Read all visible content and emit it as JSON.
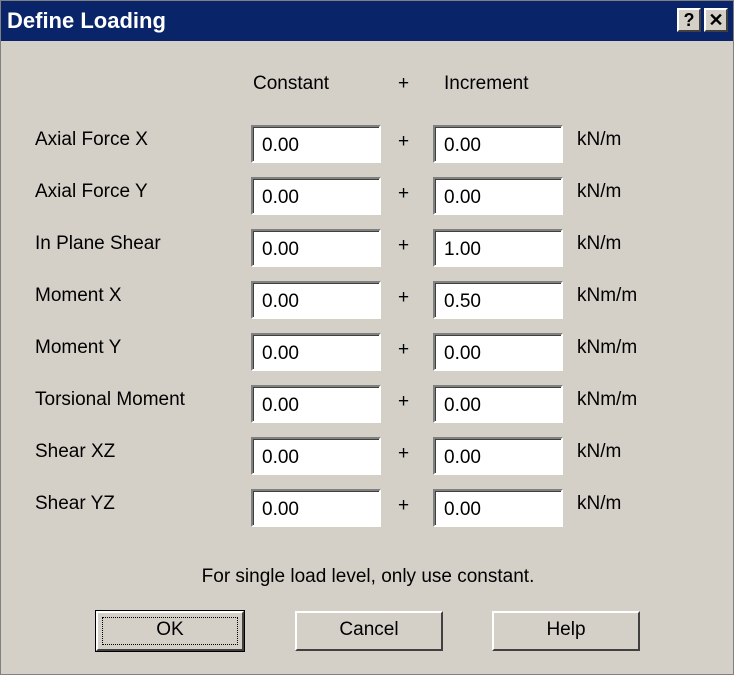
{
  "window": {
    "title": "Define Loading",
    "help_glyph": "?",
    "close_glyph": "✕"
  },
  "headers": {
    "constant": "Constant",
    "plus": "+",
    "increment": "Increment"
  },
  "rows": [
    {
      "label": "Axial Force X",
      "constant": "0.00",
      "plus": "+",
      "increment": "0.00",
      "unit": "kN/m"
    },
    {
      "label": "Axial Force Y",
      "constant": "0.00",
      "plus": "+",
      "increment": "0.00",
      "unit": "kN/m"
    },
    {
      "label": "In Plane Shear",
      "constant": "0.00",
      "plus": "+",
      "increment": "1.00",
      "unit": "kN/m"
    },
    {
      "label": "Moment X",
      "constant": "0.00",
      "plus": "+",
      "increment": "0.50",
      "unit": "kNm/m"
    },
    {
      "label": "Moment Y",
      "constant": "0.00",
      "plus": "+",
      "increment": "0.00",
      "unit": "kNm/m"
    },
    {
      "label": "Torsional Moment",
      "constant": "0.00",
      "plus": "+",
      "increment": "0.00",
      "unit": "kNm/m"
    },
    {
      "label": "Shear XZ",
      "constant": "0.00",
      "plus": "+",
      "increment": "0.00",
      "unit": "kN/m"
    },
    {
      "label": "Shear YZ",
      "constant": "0.00",
      "plus": "+",
      "increment": "0.00",
      "unit": "kN/m"
    }
  ],
  "note": "For single load level, only use constant.",
  "buttons": {
    "ok": "OK",
    "cancel": "Cancel",
    "help": "Help"
  },
  "colors": {
    "titlebar": "#0a246a",
    "dialog": "#d4d0c8"
  }
}
